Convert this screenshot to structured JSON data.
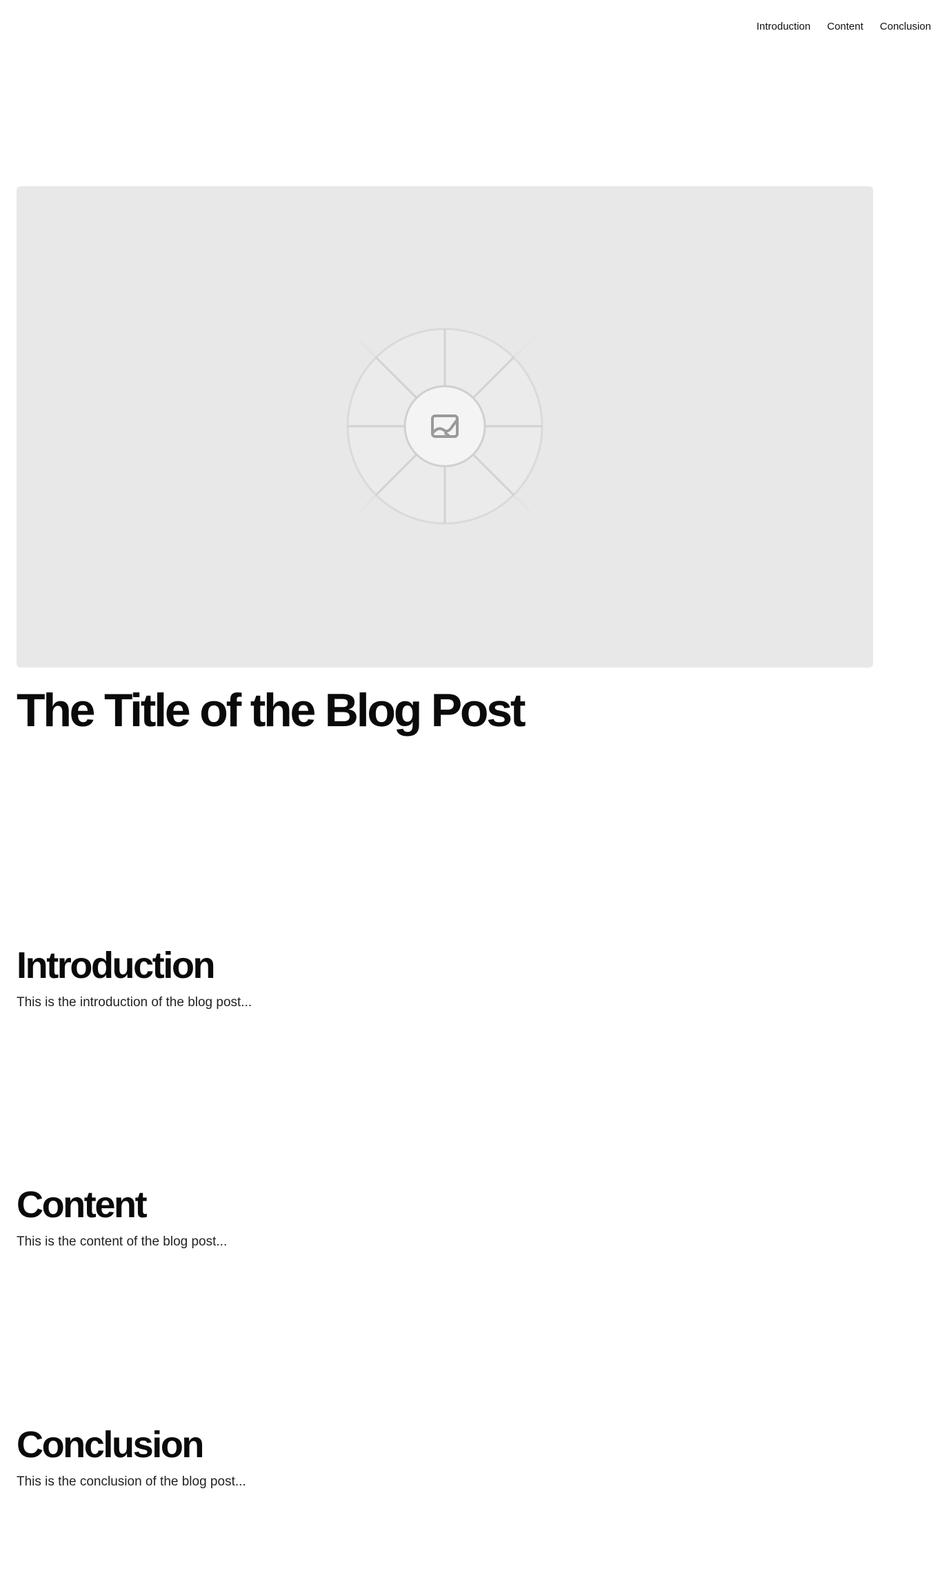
{
  "nav": {
    "items": [
      {
        "label": "Introduction"
      },
      {
        "label": "Content"
      },
      {
        "label": "Conclusion"
      }
    ]
  },
  "hero": {
    "icon": "image-placeholder-icon",
    "colors": {
      "background": "#e8e8e8",
      "lines": "#d2d2d2",
      "icon": "#9a9a9a"
    }
  },
  "post": {
    "title": "The Title of the Blog Post"
  },
  "sections": {
    "introduction": {
      "heading": "Introduction",
      "body": "This is the introduction of the blog post..."
    },
    "content": {
      "heading": "Content",
      "body": "This is the content of the blog post..."
    },
    "conclusion": {
      "heading": "Conclusion",
      "body": "This is the conclusion of the blog post..."
    }
  }
}
